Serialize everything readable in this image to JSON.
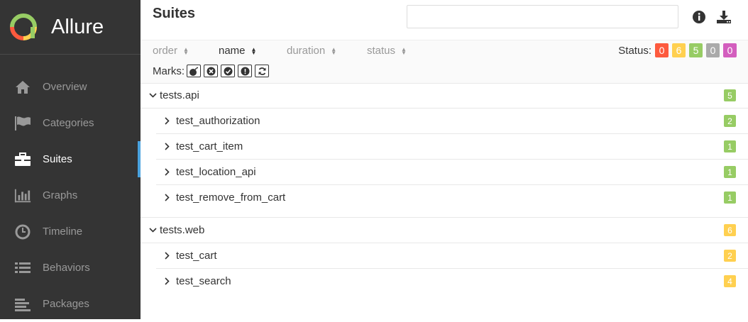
{
  "app": {
    "name": "Allure"
  },
  "sidebar": {
    "items": [
      {
        "label": "Overview",
        "icon": "home-icon"
      },
      {
        "label": "Categories",
        "icon": "flag-icon"
      },
      {
        "label": "Suites",
        "icon": "briefcase-icon",
        "active": true
      },
      {
        "label": "Graphs",
        "icon": "bar-chart-icon"
      },
      {
        "label": "Timeline",
        "icon": "clock-icon"
      },
      {
        "label": "Behaviors",
        "icon": "list-icon"
      },
      {
        "label": "Packages",
        "icon": "align-left-icon"
      }
    ]
  },
  "header": {
    "title": "Suites",
    "search_value": "",
    "search_placeholder": ""
  },
  "sorters": [
    {
      "label": "order"
    },
    {
      "label": "name",
      "active": true
    },
    {
      "label": "duration"
    },
    {
      "label": "status"
    }
  ],
  "marks": {
    "label": "Marks:"
  },
  "status_filter": {
    "label": "Status:",
    "counts": [
      {
        "value": "0",
        "color": "#fd5a3e"
      },
      {
        "value": "6",
        "color": "#ffd050"
      },
      {
        "value": "5",
        "color": "#97cc64"
      },
      {
        "value": "0",
        "color": "#aaaaaa"
      },
      {
        "value": "0",
        "color": "#d35ebe"
      }
    ]
  },
  "tree": [
    {
      "label": "tests.api",
      "count": "5",
      "color": "#97cc64",
      "children": [
        {
          "label": "test_authorization",
          "count": "2",
          "color": "#97cc64"
        },
        {
          "label": "test_cart_item",
          "count": "1",
          "color": "#97cc64"
        },
        {
          "label": "test_location_api",
          "count": "1",
          "color": "#97cc64"
        },
        {
          "label": "test_remove_from_cart",
          "count": "1",
          "color": "#97cc64"
        }
      ]
    },
    {
      "label": "tests.web",
      "count": "6",
      "color": "#ffd050",
      "children": [
        {
          "label": "test_cart",
          "count": "2",
          "color": "#ffd050"
        },
        {
          "label": "test_search",
          "count": "4",
          "color": "#ffd050"
        }
      ]
    }
  ]
}
